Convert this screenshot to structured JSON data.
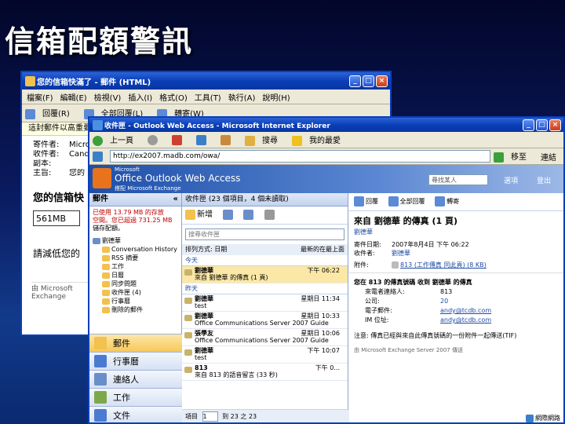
{
  "slide_title": "信箱配額警訊",
  "back_window": {
    "title": "您的信箱快滿了 - 郵件 (HTML)",
    "menu": [
      "檔案(F)",
      "編輯(E)",
      "檢視(V)",
      "插入(I)",
      "格式(O)",
      "工具(T)",
      "執行(A)",
      "說明(H)"
    ],
    "toolbar": [
      "回覆(R)",
      "全部回覆(L)",
      "轉寄(W)"
    ],
    "notice": "這封郵件以高重要",
    "fields": [
      {
        "label": "寄件者:",
        "value": "Micro"
      },
      {
        "label": "收件者:",
        "value": "Candy"
      },
      {
        "label": "副本:",
        "value": ""
      },
      {
        "label": "主旨:",
        "value": "您的"
      }
    ],
    "body_heading": "您的信箱快",
    "body_size": "561MB",
    "body_text": "請減低您的",
    "body_footer": "由 Microsoft Exchange"
  },
  "front_window": {
    "title": "收件匣 - Outlook Web Access - Microsoft Internet Explorer",
    "ie_toolbar": [
      "上一頁",
      "搜尋",
      "我的最愛"
    ],
    "address": "http://ex2007.madb.com/owa/",
    "go_label": "移至",
    "links_label": "連結",
    "logo_small": "Microsoft",
    "logo_main": "Office Outlook Web Access",
    "logo_sub": "搭配 Microsoft Exchange",
    "search_placeholder": "尋找某人",
    "options_label": "選項",
    "signout_label": "登出",
    "nav_title": "郵件",
    "quota_line1": "已使用 13.79 MB 的存放",
    "quota_line2": "空間。您已超過 731.25 MB",
    "quota_line3": "儲存配額。",
    "folders": [
      {
        "name": "劉德華",
        "level": 0
      },
      {
        "name": "Conversation History",
        "level": 1
      },
      {
        "name": "RSS 摘要",
        "level": 1
      },
      {
        "name": "工作",
        "level": 1
      },
      {
        "name": "日曆",
        "level": 1
      },
      {
        "name": "同步問題",
        "level": 1
      },
      {
        "name": "收件匣 (4)",
        "level": 1
      },
      {
        "name": "行事曆",
        "level": 1
      },
      {
        "name": "刪除的郵件",
        "level": 1
      }
    ],
    "nav_buttons": [
      {
        "label": "郵件",
        "icon": "mail-icon",
        "color": "#f2c14e"
      },
      {
        "label": "行事曆",
        "icon": "calendar-icon",
        "color": "#4a7bd0"
      },
      {
        "label": "連絡人",
        "icon": "contacts-icon",
        "color": "#6a8fc8"
      },
      {
        "label": "工作",
        "icon": "tasks-icon",
        "color": "#7da84a"
      },
      {
        "label": "文件",
        "icon": "documents-icon",
        "color": "#4a7bd0"
      }
    ],
    "inbox_header": "收件匣 (23 個項目，4 個未讀取)",
    "new_label": "新增",
    "inbox_search_placeholder": "搜尋收件匣",
    "arrange_label": "排列方式: 日期",
    "sort_label": "最新的在最上面",
    "group_today": "今天",
    "group_yesterday": "昨天",
    "messages": [
      {
        "sender": "劉德華",
        "time": "下午 06:22",
        "subject": "來自 劉德華 的傳真 (1 頁)",
        "selected": true,
        "group": "today"
      },
      {
        "sender": "劉德華",
        "time": "星期日 11:34",
        "subject": "test",
        "selected": false,
        "group": "yesterday"
      },
      {
        "sender": "劉德華",
        "time": "星期日 10:33",
        "subject": "Office Communications Server 2007 Guide",
        "selected": false,
        "group": "yesterday"
      },
      {
        "sender": "張學友",
        "time": "星期日 10:06",
        "subject": "Office Communications Server 2007 Guide",
        "selected": false,
        "group": "yesterday"
      },
      {
        "sender": "劉德華",
        "time": "下午 10:07",
        "subject": "test",
        "selected": false,
        "group": "yesterday"
      },
      {
        "sender": "813",
        "time": "下午 0...",
        "subject": "來自 813 的語音留言 (33 秒)",
        "selected": false,
        "group": "yesterday"
      }
    ],
    "pager_label": "項目",
    "pager_value": "1",
    "pager_total": "到 23 之 23",
    "reading": {
      "reply": "回覆",
      "reply_all": "全部回覆",
      "forward": "轉寄",
      "subject": "來自 劉德華 的傳真 (1 頁)",
      "sender": "劉德華",
      "sent_label": "寄件日期:",
      "sent_value": "2007年8月4日 下午 06:22",
      "to_label": "收件者:",
      "to_value": "劉德華",
      "attach_label": "附件:",
      "attach_value": "813 (工作傳真 同此頁) (8 KB)",
      "body_line1": "您在 813 的傳真號碼 收到 劉德華 的傳真",
      "caller_label": "來電者連絡人:",
      "caller_value": "813",
      "company_label": "公司:",
      "company_value": "20",
      "email_label": "電子郵件:",
      "email_value": "andy@tcdb.com",
      "im_label": "IM 位址:",
      "im_value": "andy@tcdb.com",
      "note": "注意: 傳真已經與來自此傳真號碼的一份附件一起傳送(TIF)",
      "footer": "由 Microsoft Exchange Server 2007 傳送"
    },
    "status_zone": "網際網路"
  }
}
